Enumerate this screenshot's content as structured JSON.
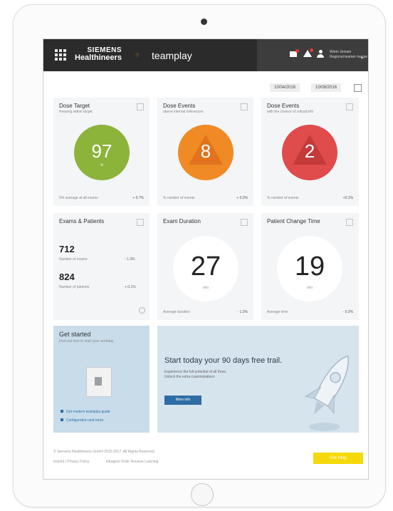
{
  "header": {
    "brand_line1": "SIEMENS",
    "brand_line2": "Healthineers",
    "app_name": "teamplay",
    "user_name": "Wiem Jensen",
    "user_role": "Regional teamer macpe"
  },
  "date_range": {
    "from": "10/04/2016",
    "to": "10/08/2016"
  },
  "cards": {
    "dose_target": {
      "title": "Dose Target",
      "subtitle": "Keeping within target",
      "value": "97",
      "unit": "%",
      "footer_left": "5% average at all exams",
      "footer_right": "+ 0.7%",
      "color": "#8cb33a"
    },
    "dose_events_1": {
      "title": "Dose Events",
      "subtitle": "above internal references",
      "value": "8",
      "footer_left": "% number of events",
      "footer_right": "+ 0.2%",
      "color": "#f08a24"
    },
    "dose_events_2": {
      "title": "Dose Events",
      "subtitle": "with the chance of critical info",
      "value": "2",
      "footer_left": "% number of events",
      "footer_right": "+0.1%",
      "color": "#e04b4b"
    },
    "exams_patients": {
      "title": "Exams & Patients",
      "exams_value": "712",
      "exams_label": "Number of exams",
      "exams_trend": "- 1.3%",
      "patients_value": "824",
      "patients_label": "Number of patients",
      "patients_trend": "+ 0.1%"
    },
    "exam_duration": {
      "title": "Exam Duration",
      "value": "27",
      "unit": "min",
      "footer_left": "Average duration",
      "footer_right": "- 1.2%"
    },
    "patient_change": {
      "title": "Patient Change Time",
      "value": "19",
      "unit": "min",
      "footer_left": "Average time",
      "footer_right": "- 0.2%"
    }
  },
  "get_started": {
    "title": "Get started",
    "subtitle": "Find out how to start your workday",
    "link1": "Get modern teamplay guide",
    "link2": "Configuration and more"
  },
  "promo": {
    "title": "Start today your 90 days free trail.",
    "text_line1": "Experience the full potential of all three.",
    "text_line2": "Unlock the extra customizations",
    "button_label": "More info"
  },
  "footer": {
    "copyright": "© Siemens Healthineers GmbH 2015-2017. All Rights Reserved.",
    "links_left": "Imprint | Privacy Policy",
    "links_right": "Inkagent Order Receive Learning",
    "support_label": "Get Help"
  }
}
